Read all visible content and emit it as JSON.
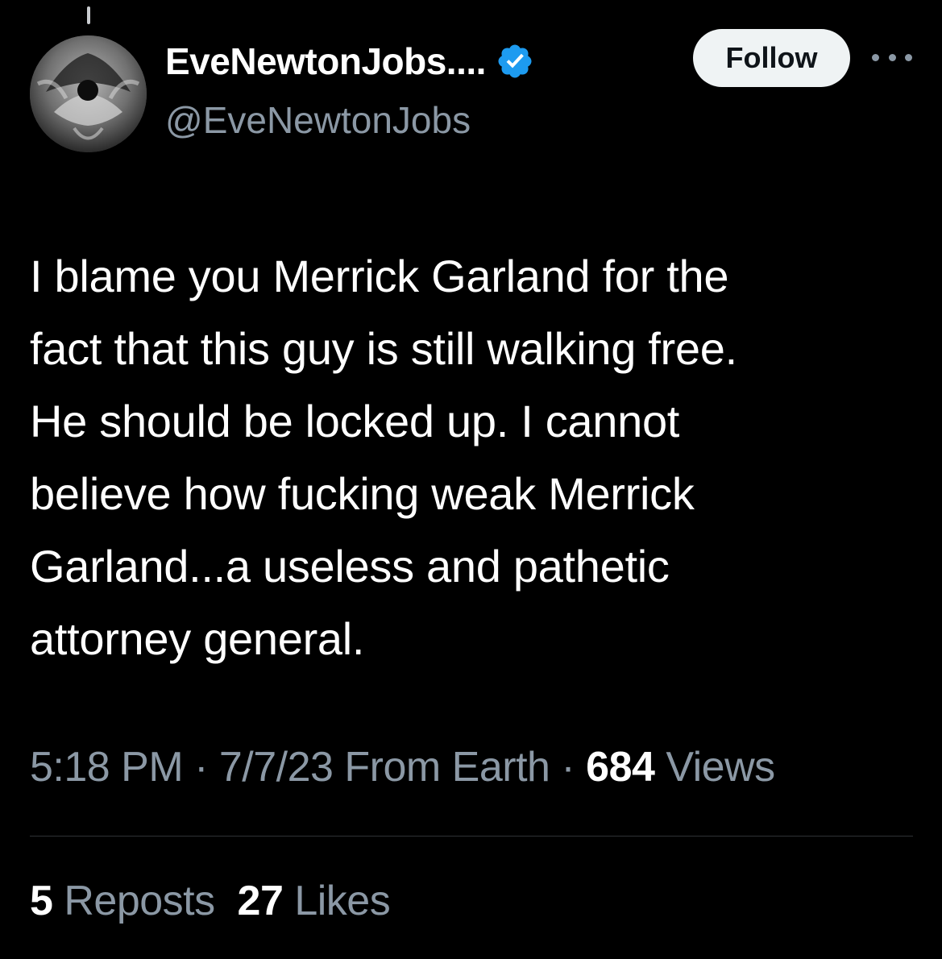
{
  "author": {
    "display_name": "EveNewtonJobs....",
    "handle": "@EveNewtonJobs",
    "verified": true,
    "avatar_icon": "profile-photo"
  },
  "follow_label": "Follow",
  "more_icon": "more-horizontal-icon",
  "tweet": {
    "lines": [
      "I blame you Merrick Garland for the",
      "fact that this guy is still walking free.",
      "He should be locked up. I cannot",
      "believe how fucking weak Merrick",
      "Garland...a useless and pathetic",
      "attorney general."
    ]
  },
  "meta": {
    "time": "5:18 PM",
    "sep1": " · ",
    "date": "7/7/23",
    "source": " From Earth",
    "sep2": " · ",
    "views_count": "684",
    "views_label": " Views"
  },
  "stats": {
    "reposts_count": "5",
    "reposts_label": " Reposts",
    "likes_count": "27",
    "likes_label": " Likes"
  },
  "colors": {
    "background": "#000000",
    "primary_text": "#ffffff",
    "secondary_text": "#8b98a5",
    "verified_badge": "#1d9bf0",
    "follow_button_bg": "#eff3f4",
    "divider": "#2f3336"
  }
}
